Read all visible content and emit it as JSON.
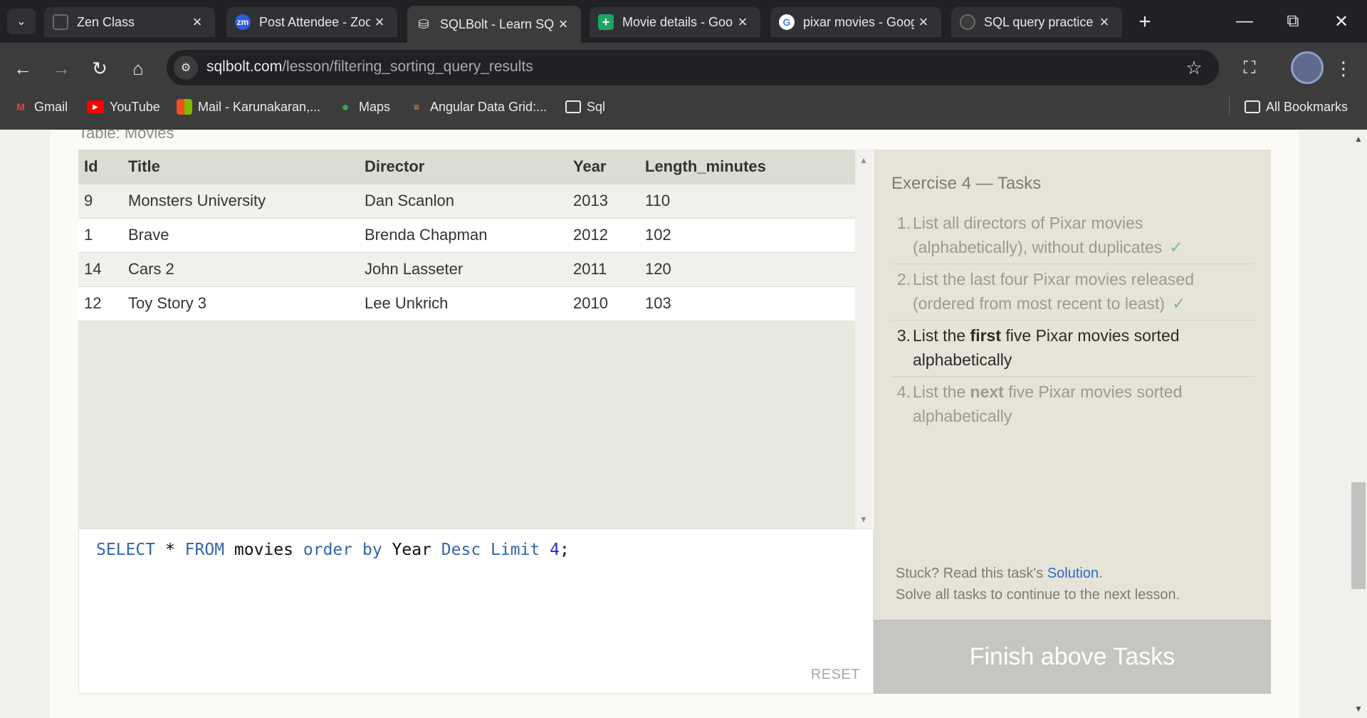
{
  "browser": {
    "tabs": [
      {
        "title": "Zen Class",
        "favicon": "zen-class-icon",
        "active": false
      },
      {
        "title": "Post Attendee - Zoom",
        "favicon": "zoom-icon",
        "active": false
      },
      {
        "title": "SQLBolt - Learn SQL",
        "favicon": "database-icon",
        "active": true
      },
      {
        "title": "Movie details - Google Sheets",
        "favicon": "sheets-icon",
        "active": false
      },
      {
        "title": "pixar movies - Google Search",
        "favicon": "google-icon",
        "active": false
      },
      {
        "title": "SQL query practice",
        "favicon": "github-icon",
        "active": false
      }
    ],
    "url_host": "sqlbolt.com",
    "url_path": "/lesson/filtering_sorting_query_results",
    "bookmarks": [
      {
        "label": "Gmail",
        "icon": "gmail-icon"
      },
      {
        "label": "YouTube",
        "icon": "youtube-icon"
      },
      {
        "label": "Mail - Karunakaran,...",
        "icon": "microsoft-icon"
      },
      {
        "label": "Maps",
        "icon": "maps-icon"
      },
      {
        "label": "Angular Data Grid:...",
        "icon": "ag-grid-icon"
      },
      {
        "label": "Sql",
        "icon": "folder-icon"
      }
    ],
    "all_bookmarks": "All Bookmarks"
  },
  "lesson": {
    "table_caption": "Table: Movies",
    "table": {
      "columns": [
        "Id",
        "Title",
        "Director",
        "Year",
        "Length_minutes"
      ],
      "rows": [
        [
          "9",
          "Monsters University",
          "Dan Scanlon",
          "2013",
          "110"
        ],
        [
          "1",
          "Brave",
          "Brenda Chapman",
          "2012",
          "102"
        ],
        [
          "14",
          "Cars 2",
          "John Lasseter",
          "2011",
          "120"
        ],
        [
          "12",
          "Toy Story 3",
          "Lee Unkrich",
          "2010",
          "103"
        ]
      ]
    },
    "query": {
      "select": "SELECT",
      "star": "*",
      "from": "FROM",
      "table": "movies",
      "order": "order",
      "by": "by",
      "column": "Year",
      "desc": "Desc",
      "limit": "Limit",
      "count": "4",
      "end": ";"
    },
    "reset_label": "RESET",
    "tasks_heading": "Exercise 4 — Tasks",
    "tasks": [
      {
        "num": "1.",
        "text": "List all directors of Pixar movies (alphabetically), without duplicates",
        "done": true
      },
      {
        "num": "2.",
        "text": "List the last four Pixar movies released (ordered from most recent to least)",
        "done": true
      },
      {
        "num": "3.",
        "pre": "List the ",
        "bold": "first",
        "post": " five Pixar movies sorted alphabetically",
        "done": false
      },
      {
        "num": "4.",
        "pre": "List the ",
        "bold": "next",
        "post": " five Pixar movies sorted alphabetically",
        "done": false
      }
    ],
    "check_mark": "✓",
    "stuck_text": "Stuck? Read this task's ",
    "solution_link": "Solution",
    "stuck_end": ".",
    "solve_all_text": "Solve all tasks to continue to the next lesson.",
    "finish_label": "Finish above Tasks"
  }
}
